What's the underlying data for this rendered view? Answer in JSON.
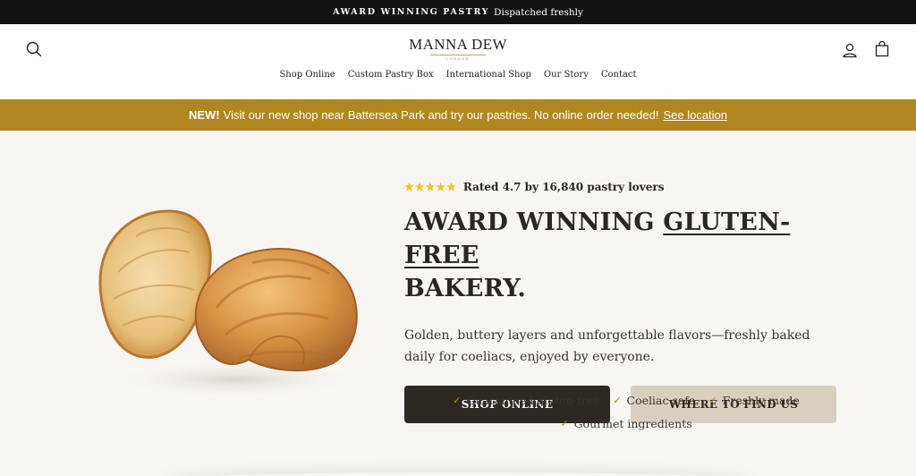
{
  "announcement": {
    "strong": "AWARD WINNING PASTRY",
    "text": "Dispatched freshly"
  },
  "header": {
    "logo_name": "MANNA DEW",
    "logo_sub": "LONDON",
    "icons": [
      "search-icon",
      "account-icon",
      "cart-icon"
    ],
    "nav": [
      "Shop Online",
      "Custom Pastry Box",
      "International Shop",
      "Our Story",
      "Contact"
    ]
  },
  "promo": {
    "badge": "NEW!",
    "text": "Visit our new shop near Battersea Park and try our pastries. No online order needed!",
    "link": "See location",
    "color": "#b2861f"
  },
  "hero": {
    "stars": 5,
    "rating_text": "Rated 4.7 by 16,840 pastry lovers",
    "headline_part1": "AWARD WINNING ",
    "headline_underlined": "GLUTEN-FREE",
    "headline_part2": "BAKERY.",
    "description": "Golden, buttery layers and unforgettable flavors—freshly baked daily for coeliacs, enjoyed by everyone.",
    "primary_button": "SHOP ONLINE",
    "secondary_button": "WHERE TO FIND US",
    "features": [
      "Guaranteed gluten-free",
      "Coeliac safe",
      "Freshly made",
      "Gourmet ingredients"
    ]
  },
  "colors": {
    "dark": "#2e2823",
    "gold": "#b2861f",
    "star": "#f6c400",
    "secondary_button": "#d8cfc0"
  }
}
